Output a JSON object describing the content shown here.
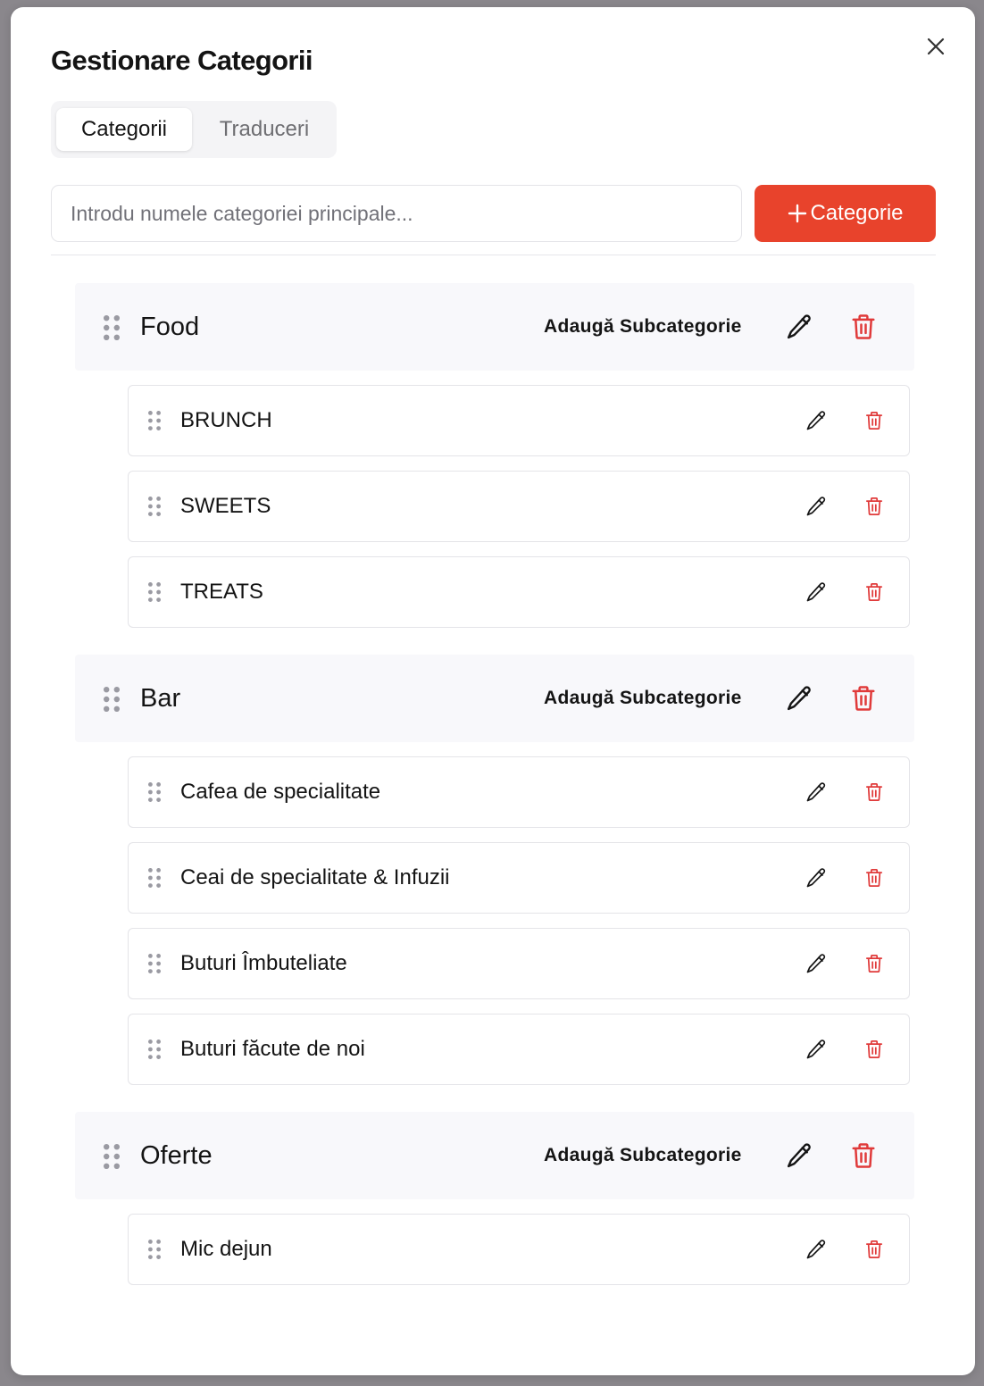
{
  "modal": {
    "title": "Gestionare Categorii",
    "tabs": [
      {
        "label": "Categorii",
        "active": true
      },
      {
        "label": "Traduceri",
        "active": false
      }
    ],
    "input": {
      "value": "",
      "placeholder": "Introdu numele categoriei principale..."
    },
    "add_button_label": "Categorie",
    "add_button_icon": "plus-icon",
    "close_icon": "close-icon"
  },
  "colors": {
    "accent": "#e8432c",
    "delete": "#e03a3a",
    "main_row_bg": "#f8f8fb"
  },
  "add_sub_label": "Adaugă Subcategorie",
  "icons": {
    "drag": "drag-handle-icon",
    "edit": "pencil-icon",
    "delete": "trash-icon"
  },
  "categories": [
    {
      "name": "Food",
      "subcategories": [
        "BRUNCH",
        "SWEETS",
        "TREATS"
      ]
    },
    {
      "name": "Bar",
      "subcategories": [
        "Cafea de specialitate",
        "Ceai de specialitate & Infuzii",
        "Buturi Îmbuteliate",
        "Buturi făcute de noi"
      ]
    },
    {
      "name": "Oferte",
      "subcategories": [
        "Mic dejun"
      ]
    }
  ]
}
